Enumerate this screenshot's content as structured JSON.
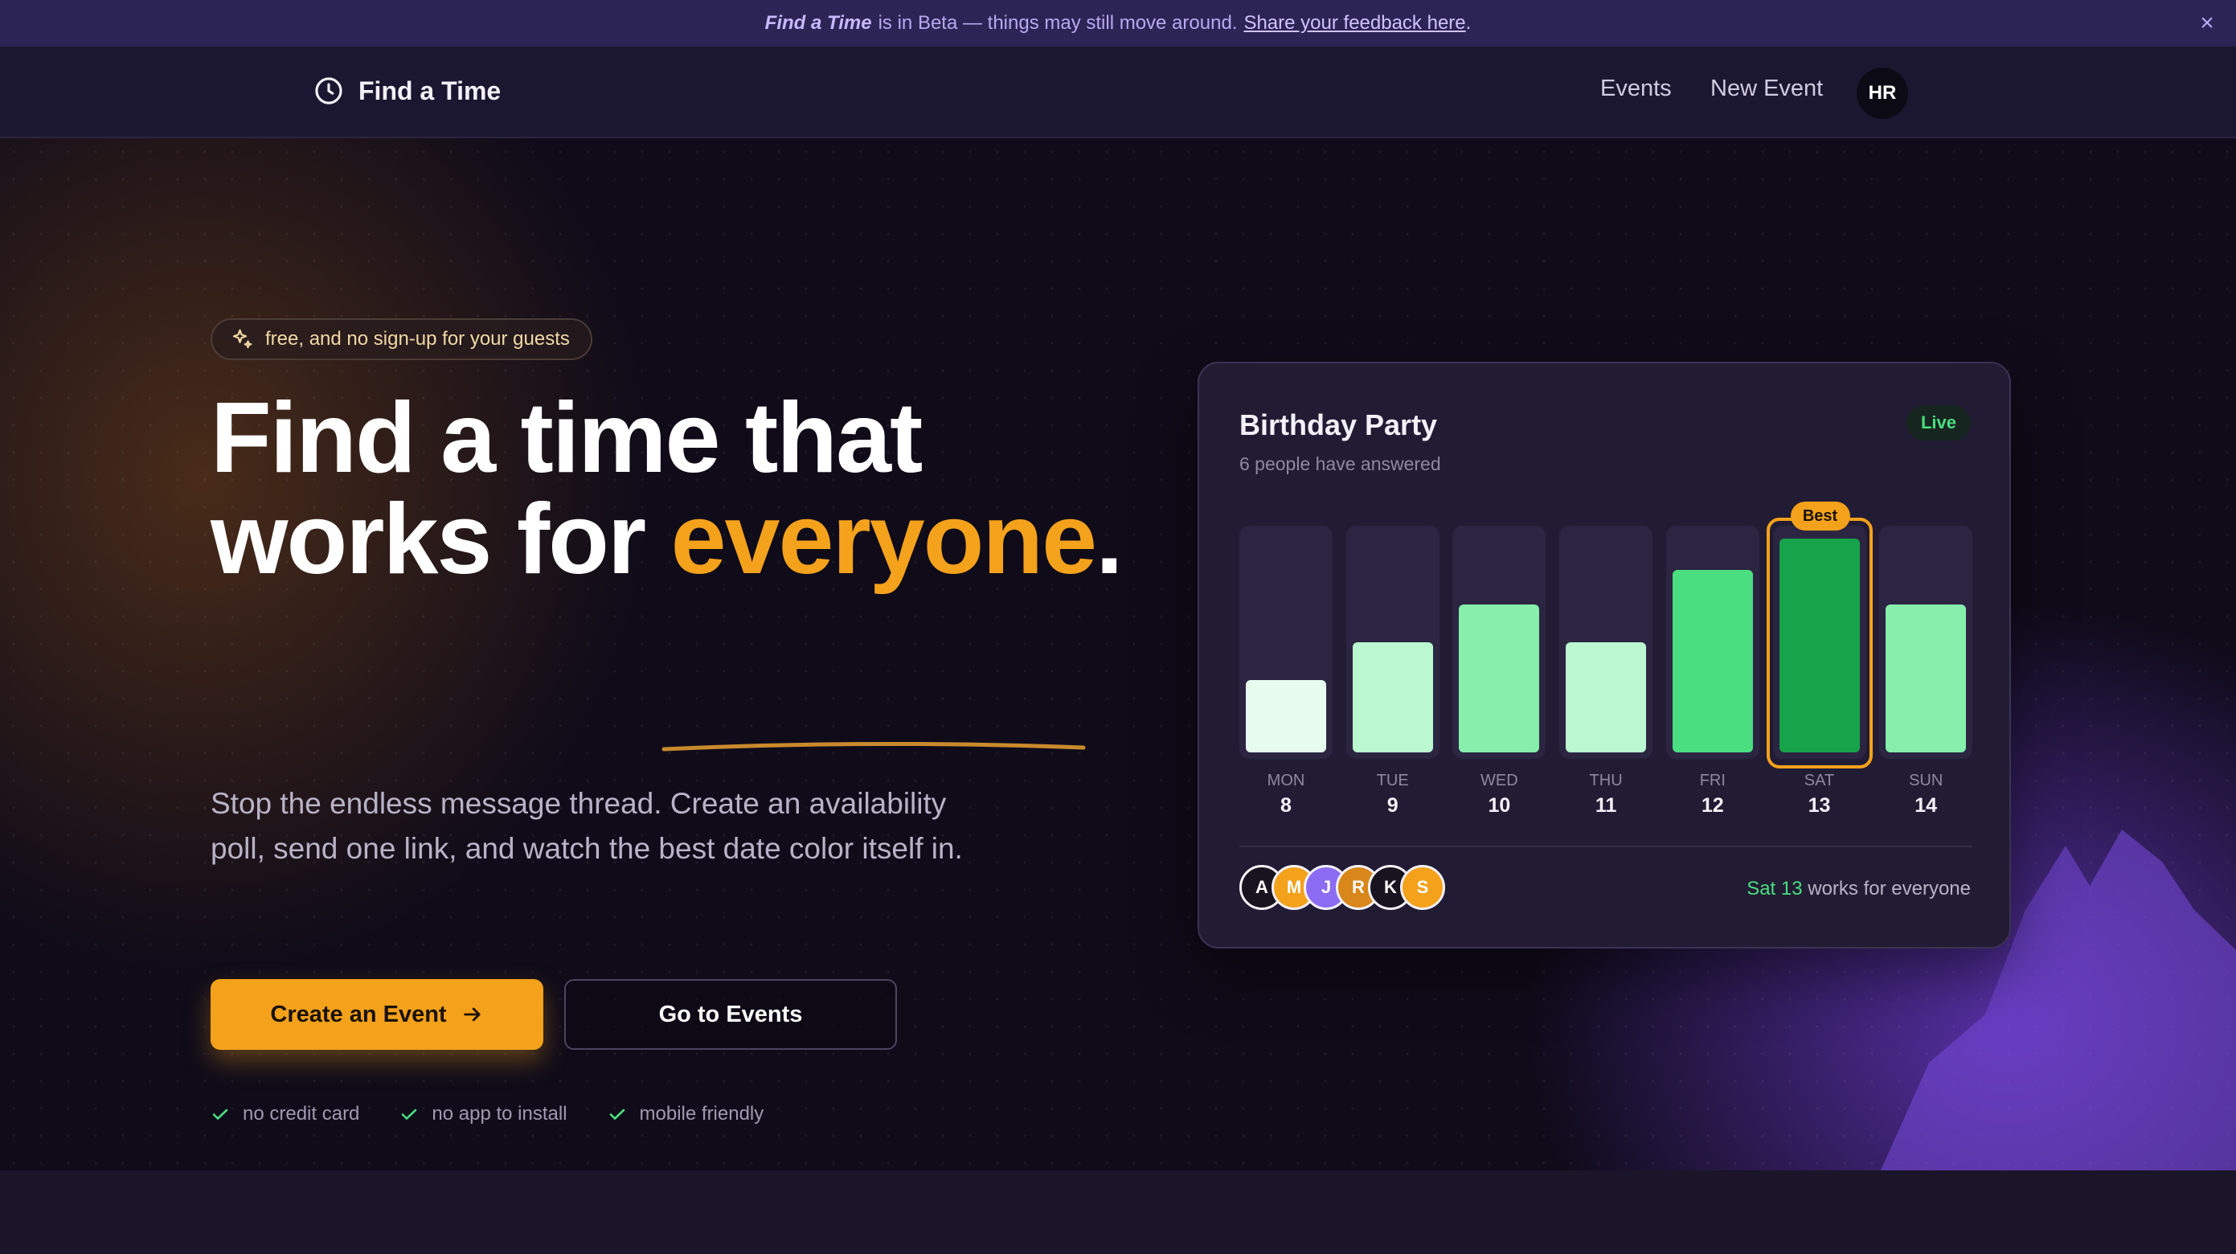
{
  "banner": {
    "product": "Find a Time",
    "text": "is in Beta — things may still move around.",
    "link": "Share your feedback here",
    "period": ".",
    "close": "×"
  },
  "nav": {
    "brand": "Find a Time",
    "links": [
      "Events",
      "New Event"
    ],
    "avatar": "HR"
  },
  "hero": {
    "pill": "free, and no sign-up for your guests",
    "headline_line1": "Find a time that",
    "headline_line2_prefix": "works for ",
    "headline_highlight": "everyone",
    "headline_end": ".",
    "subtext": "Stop the endless message thread. Create an availability poll, send one link, and watch the best date color itself in.",
    "primary_cta": "Create an Event",
    "secondary_cta": "Go to Events",
    "features": [
      "no credit card",
      "no app to install",
      "mobile friendly"
    ]
  },
  "card": {
    "title": "Birthday Party",
    "subtitle": "6 people have answered",
    "status": "Live",
    "best_label": "Best",
    "days": [
      {
        "name": "MON",
        "num": "8",
        "level": 0.33
      },
      {
        "name": "TUE",
        "num": "9",
        "level": 0.5
      },
      {
        "name": "WED",
        "num": "10",
        "level": 0.67
      },
      {
        "name": "THU",
        "num": "11",
        "level": 0.5
      },
      {
        "name": "FRI",
        "num": "12",
        "level": 0.83
      },
      {
        "name": "SAT",
        "num": "13",
        "level": 1.0,
        "best": true
      },
      {
        "name": "SUN",
        "num": "14",
        "level": 0.67
      }
    ],
    "avatars": [
      {
        "initial": "A",
        "color": "#18141f"
      },
      {
        "initial": "M",
        "color": "#f4a11c"
      },
      {
        "initial": "J",
        "color": "#8b6cf2"
      },
      {
        "initial": "R",
        "color": "#d9861a"
      },
      {
        "initial": "K",
        "color": "#18141f"
      },
      {
        "initial": "S",
        "color": "#f4a11c"
      }
    ],
    "works_highlight": "Sat 13",
    "works_text": " works for everyone"
  },
  "colors": {
    "accent": "#f4a11c",
    "success": "#4ade80",
    "banner_bg": "#2c2455"
  }
}
